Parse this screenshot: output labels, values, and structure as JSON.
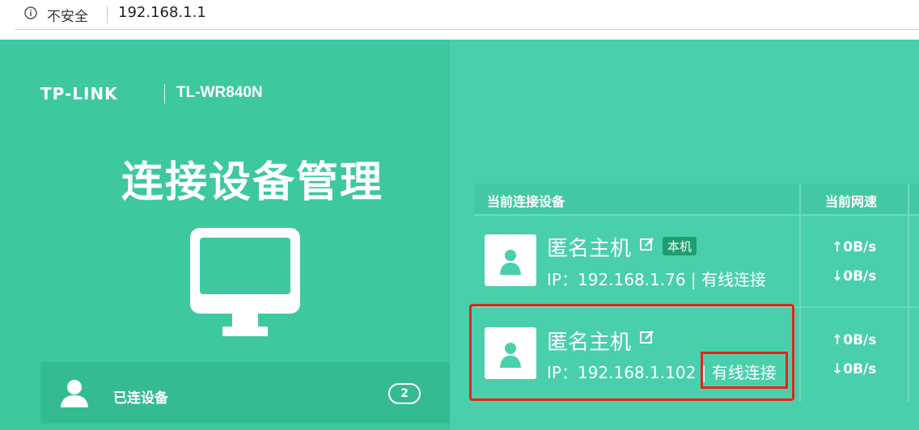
{
  "browser": {
    "security_label": "不安全",
    "url": "192.168.1.1"
  },
  "brand": {
    "logo": "TP-LINK",
    "model": "TL-WR840N"
  },
  "page": {
    "title": "连接设备管理"
  },
  "sidebar": {
    "connected_label": "已连设备",
    "connected_count": "2"
  },
  "table": {
    "headers": [
      "当前连接设备",
      "当前网速"
    ],
    "devices": [
      {
        "name": "匿名主机",
        "badge": "本机",
        "ip_prefix": "IP：",
        "ip": "192.168.1.76",
        "sep": " | ",
        "connection": "有线连接",
        "up": "0B/s",
        "down": "0B/s"
      },
      {
        "name": "匿名主机",
        "ip_prefix": "IP：",
        "ip": "192.168.1.102",
        "sep": " | ",
        "connection": "有线连接",
        "up": "0B/s",
        "down": "0B/s"
      }
    ]
  },
  "icons": {
    "up_arrow": "↑",
    "down_arrow": "↓"
  },
  "colors": {
    "main_bg": "#49cfac",
    "left_bg": "#3ec89f",
    "highlight": "#e8231a",
    "badge_bg": "#1e9e6f"
  }
}
